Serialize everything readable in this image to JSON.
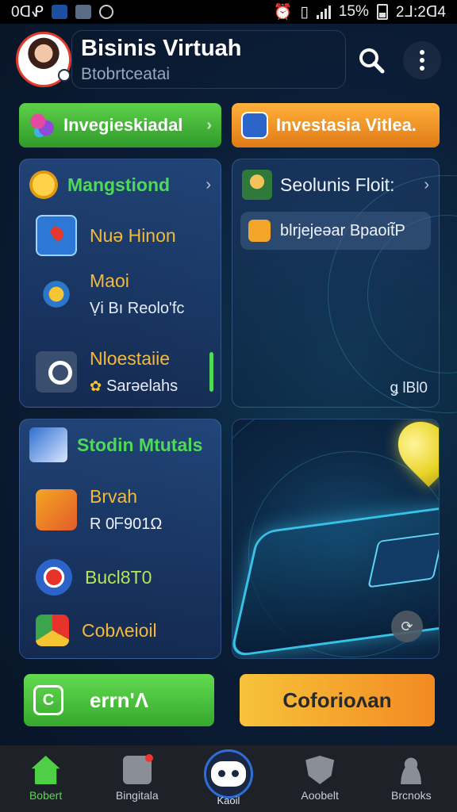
{
  "status_bar": {
    "time": "0ᗡᕵ",
    "battery": "15%",
    "clock": "2ᒧ:2ᗡ4"
  },
  "header": {
    "title": "Bisinis Virtuah",
    "subtitle": "Btobrtceatai"
  },
  "top_buttons": {
    "left_label": "Invegieskiadal",
    "right_label": "Investasia Vitlea."
  },
  "card_main": {
    "title": "Mangstiond",
    "items": [
      {
        "line1": "Nuə Hinon",
        "line2": ""
      },
      {
        "line1": "Maoi",
        "line2": "Ṿi Bı Reolo'fc"
      },
      {
        "line1": "Nloestaiie",
        "line2": "Sarəelahs"
      }
    ]
  },
  "card_right": {
    "title": "Seolunis Floit:",
    "pill_text": "blrjejeəar Bpaoit̃P",
    "meta": "ǥ lBl0"
  },
  "card_studio": {
    "title": "Stodin Mtutals",
    "items": [
      {
        "line1": "Brvah",
        "line2": "R 0ᖴ901Ω"
      },
      {
        "line1": "Bucl8T0",
        "line2": ""
      },
      {
        "line1": "Cobᴧeioil",
        "line2": ""
      }
    ]
  },
  "bottom_buttons": {
    "left_label": "errn'Λ",
    "right_label": "Coforioᴧan"
  },
  "bottom_nav": [
    {
      "label": "Bobert",
      "icon": "home-icon"
    },
    {
      "label": "Bingitala",
      "icon": "bag-icon"
    },
    {
      "label": "Kaoil",
      "icon": "assistant-icon"
    },
    {
      "label": "Aoobelt",
      "icon": "shield-icon"
    },
    {
      "label": "Brcnoks",
      "icon": "user-icon"
    }
  ],
  "colors": {
    "accent_green": "#4fd85a",
    "accent_orange": "#f28a22",
    "accent_blue": "#2d6fd8",
    "background": "#0a1428"
  }
}
